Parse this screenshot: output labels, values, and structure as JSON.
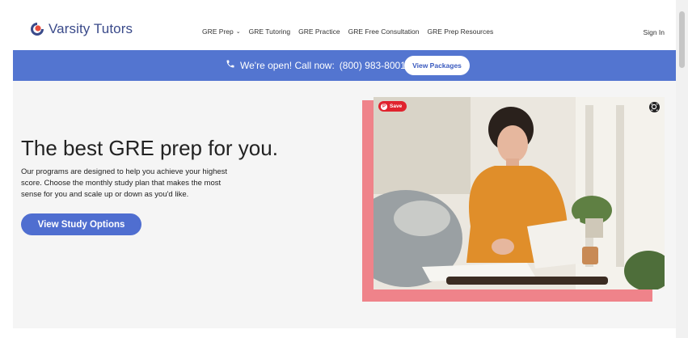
{
  "brand": {
    "name": "Varsity Tutors",
    "accent": "#5375d0"
  },
  "nav": {
    "items": [
      {
        "label": "GRE Prep",
        "has_dropdown": true
      },
      {
        "label": "GRE Tutoring"
      },
      {
        "label": "GRE Practice"
      },
      {
        "label": "GRE Free Consultation"
      },
      {
        "label": "GRE Prep Resources"
      }
    ],
    "sign_in": "Sign In"
  },
  "banner": {
    "call_text": "We're open! Call now:",
    "phone": "(800) 983-8001",
    "button": "View Packages",
    "icon": "phone-icon"
  },
  "hero": {
    "title": "The best GRE prep for you.",
    "description": "Our programs are designed to help you achieve your highest score. Choose the monthly study plan that makes the most sense for you and scale up or down as you'd like.",
    "button": "View Study Options",
    "pinterest_save": "Save",
    "colors": {
      "frame": "#ef838a",
      "button": "#4f6ed0"
    }
  }
}
